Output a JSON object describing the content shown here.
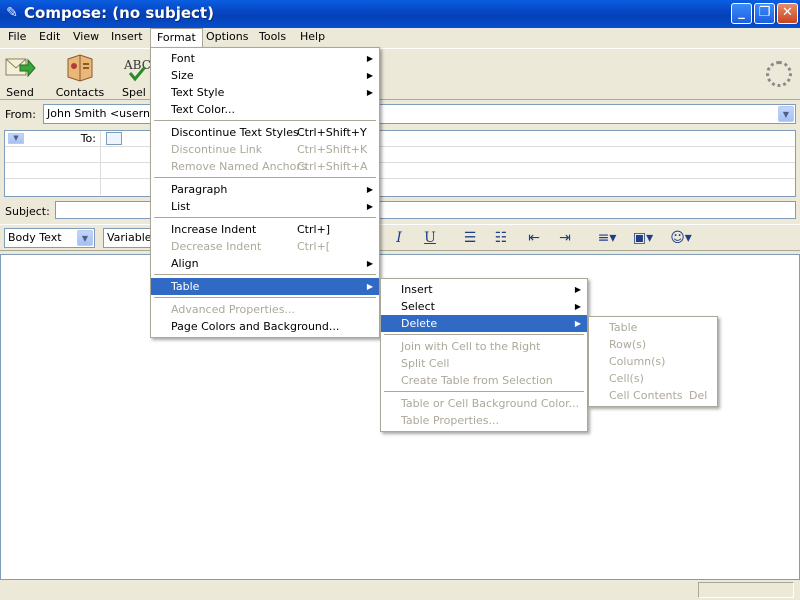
{
  "window": {
    "title": "Compose: (no subject)",
    "minimize": "_",
    "maximize": "❐",
    "close": "✕"
  },
  "menubar": [
    {
      "label": "File"
    },
    {
      "label": "Edit"
    },
    {
      "label": "View"
    },
    {
      "label": "Insert"
    },
    {
      "label": "Format"
    },
    {
      "label": "Options"
    },
    {
      "label": "Tools"
    },
    {
      "label": "Help"
    }
  ],
  "toolbar": {
    "send": "Send",
    "contacts": "Contacts",
    "spell": "Spel"
  },
  "address": {
    "from_label": "From:",
    "from_value": "John Smith <usernam",
    "to_label": "To:",
    "subject_label": "Subject:"
  },
  "format_toolbar": {
    "paragraph_style": "Body Text",
    "font": "Variable"
  },
  "format_menu": {
    "font": "Font",
    "size": "Size",
    "text_style": "Text Style",
    "text_color": "Text Color...",
    "discontinue_styles": "Discontinue Text Styles",
    "discontinue_styles_sc": "Ctrl+Shift+Y",
    "discontinue_link": "Discontinue Link",
    "discontinue_link_sc": "Ctrl+Shift+K",
    "remove_anchors": "Remove Named Anchors",
    "remove_anchors_sc": "Ctrl+Shift+A",
    "paragraph": "Paragraph",
    "list": "List",
    "increase_indent": "Increase Indent",
    "increase_indent_sc": "Ctrl+]",
    "decrease_indent": "Decrease Indent",
    "decrease_indent_sc": "Ctrl+[",
    "align": "Align",
    "table": "Table",
    "advanced_props": "Advanced Properties...",
    "page_colors": "Page Colors and Background..."
  },
  "table_menu": {
    "insert": "Insert",
    "select": "Select",
    "delete": "Delete",
    "join_cells": "Join with Cell to the Right",
    "split_cell": "Split Cell",
    "create_table": "Create Table from Selection",
    "bg_color": "Table or Cell Background Color...",
    "table_props": "Table Properties..."
  },
  "delete_menu": {
    "table": "Table",
    "rows": "Row(s)",
    "columns": "Column(s)",
    "cells": "Cell(s)",
    "cell_contents": "Cell Contents",
    "cell_contents_sc": "Del"
  },
  "colors": {
    "titlebar": "#0842c3",
    "highlight": "#316ac5",
    "disabled": "#aca899",
    "chrome": "#ece9d8"
  }
}
